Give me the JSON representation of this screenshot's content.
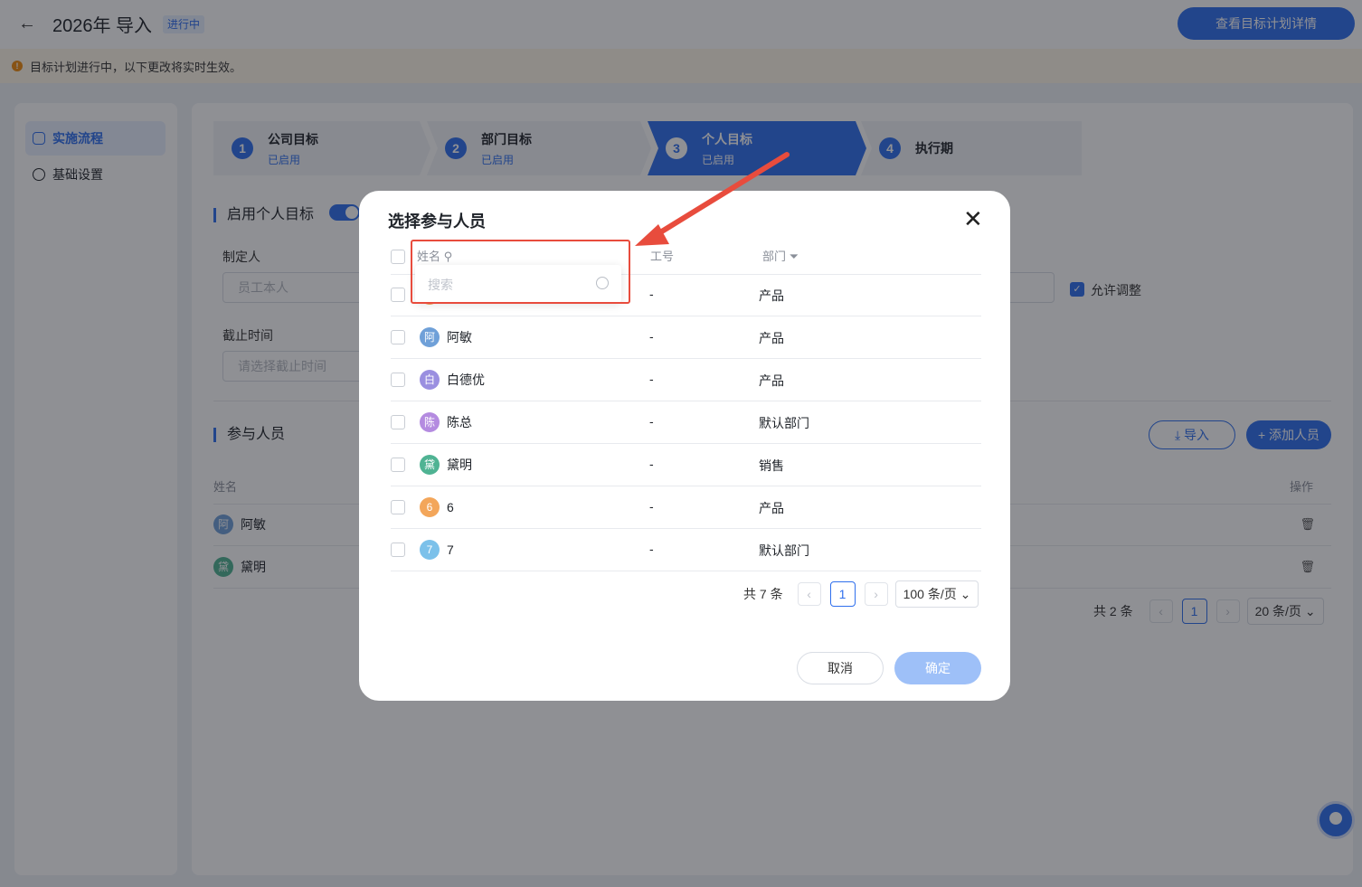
{
  "header": {
    "back_icon": "arrow-left-icon",
    "title": "2026年 导入",
    "status_badge": "进行中",
    "detail_button": "查看目标计划详情"
  },
  "notice": {
    "text": "目标计划进行中，以下更改将实时生效。",
    "icon": "info-icon"
  },
  "sidebar": {
    "items": [
      {
        "label": "实施流程",
        "icon": "flow-icon",
        "active": true
      },
      {
        "label": "基础设置",
        "icon": "gear-icon",
        "active": false
      }
    ]
  },
  "steps": [
    {
      "num": "1",
      "title": "公司目标",
      "status": "已启用"
    },
    {
      "num": "2",
      "title": "部门目标",
      "status": "已启用"
    },
    {
      "num": "3",
      "title": "个人目标",
      "status": "已启用"
    },
    {
      "num": "4",
      "title": "执行期",
      "status": ""
    }
  ],
  "personal": {
    "section_title": "启用个人目标",
    "creator_label": "制定人",
    "creator_value": "员工本人",
    "deadline_label": "截止时间",
    "deadline_placeholder": "请选择截止时间",
    "allow_adjust": "允许调整"
  },
  "participants": {
    "section_title": "参与人员",
    "import_button": "导入",
    "add_button": "添加人员",
    "col_name": "姓名",
    "col_action": "操作",
    "rows": [
      {
        "avatar": "阿",
        "name": "阿敏",
        "color": "#6fa0d8"
      },
      {
        "avatar": "黛",
        "name": "黛明",
        "color": "#4fb393"
      }
    ],
    "total": "共 2 条",
    "page": "1",
    "page_size": "20 条/页"
  },
  "modal": {
    "title": "选择参与人员",
    "col_name": "姓名",
    "col_id": "工号",
    "col_dept": "部门",
    "search_placeholder": "搜索",
    "rows": [
      {
        "avatar": "",
        "name": "",
        "id": "-",
        "dept": "产品",
        "color": "#f3a65a"
      },
      {
        "avatar": "阿",
        "name": "阿敏",
        "id": "-",
        "dept": "产品",
        "color": "#6fa0d8"
      },
      {
        "avatar": "白",
        "name": "白德优",
        "id": "-",
        "dept": "产品",
        "color": "#9a8fe0"
      },
      {
        "avatar": "陈",
        "name": "陈总",
        "id": "-",
        "dept": "默认部门",
        "color": "#b48be0"
      },
      {
        "avatar": "黛",
        "name": "黛明",
        "id": "-",
        "dept": "销售",
        "color": "#4fb393"
      },
      {
        "avatar": "6",
        "name": "6",
        "id": "-",
        "dept": "产品",
        "color": "#f3a65a"
      },
      {
        "avatar": "7",
        "name": "7",
        "id": "-",
        "dept": "默认部门",
        "color": "#7cc1ea"
      }
    ],
    "total": "共 7 条",
    "page": "1",
    "page_size": "100 条/页",
    "cancel": "取消",
    "confirm": "确定"
  },
  "colors": {
    "accent": "#2f6fed",
    "annotation": "#e84c3d"
  }
}
